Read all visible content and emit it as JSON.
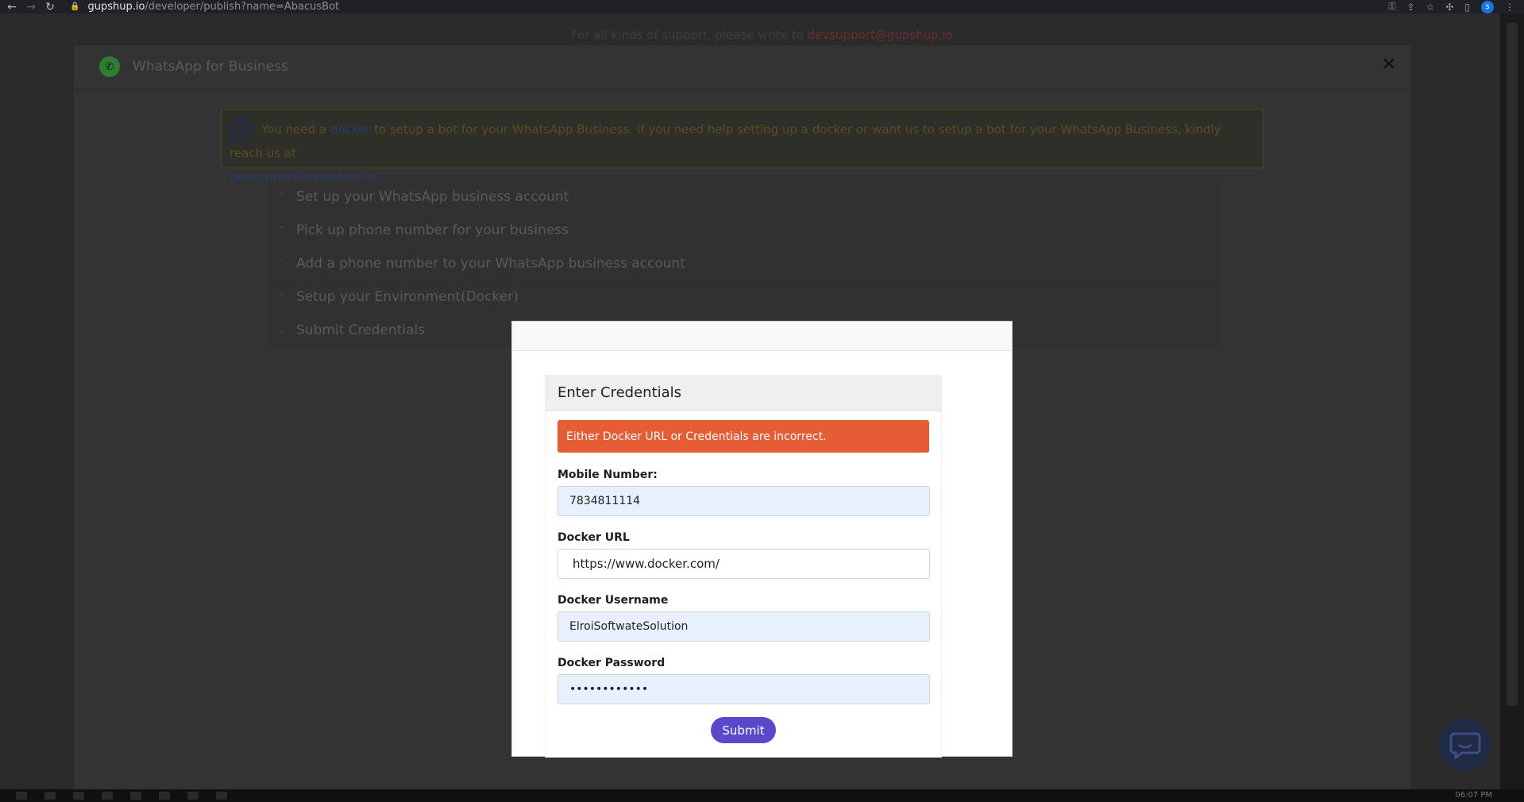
{
  "browser": {
    "url_host": "gupshup.io",
    "url_path": "/developer/publish?name=AbacusBot",
    "profile_initial": "s"
  },
  "page": {
    "support_text": "For all kinds of support, please write to",
    "support_email": "devsupport@gupshup.io"
  },
  "panel": {
    "title": "WhatsApp for Business",
    "close_label": "✕",
    "info": {
      "text_before": "You need a",
      "link_docker": "docker",
      "text_after": "to setup a bot for your WhatsApp Business. If you need help setting up a docker or want us to setup a bot for your WhatsApp Business, kindly reach us at",
      "email": "devsupport@gupshup.io"
    },
    "steps": [
      {
        "label": "Set up your WhatsApp business account",
        "chevron": "⌃"
      },
      {
        "label": "Pick up phone number for your business",
        "chevron": "⌃"
      },
      {
        "label": "Add a phone number to your WhatsApp business account",
        "chevron": "⌃"
      },
      {
        "label": "Setup your Environment(Docker)",
        "chevron": "⌃"
      },
      {
        "label": "Submit Credentials",
        "chevron": "⌄"
      }
    ]
  },
  "modal": {
    "title": "Enter Credentials",
    "error": "Either Docker URL or Credentials are incorrect.",
    "fields": {
      "mobile": {
        "label": "Mobile Number:",
        "value": "7834811114"
      },
      "docker_url": {
        "label": "Docker URL",
        "value": "https://www.docker.com/"
      },
      "username": {
        "label": "Docker Username",
        "value": "ElroiSoftwateSolution"
      },
      "password": {
        "label": "Docker Password",
        "value": "••••••••••••"
      }
    },
    "submit_label": "Submit"
  },
  "taskbar": {
    "time": "06:07 PM"
  },
  "colors": {
    "accent": "#5848cc",
    "error": "#e65c35"
  }
}
